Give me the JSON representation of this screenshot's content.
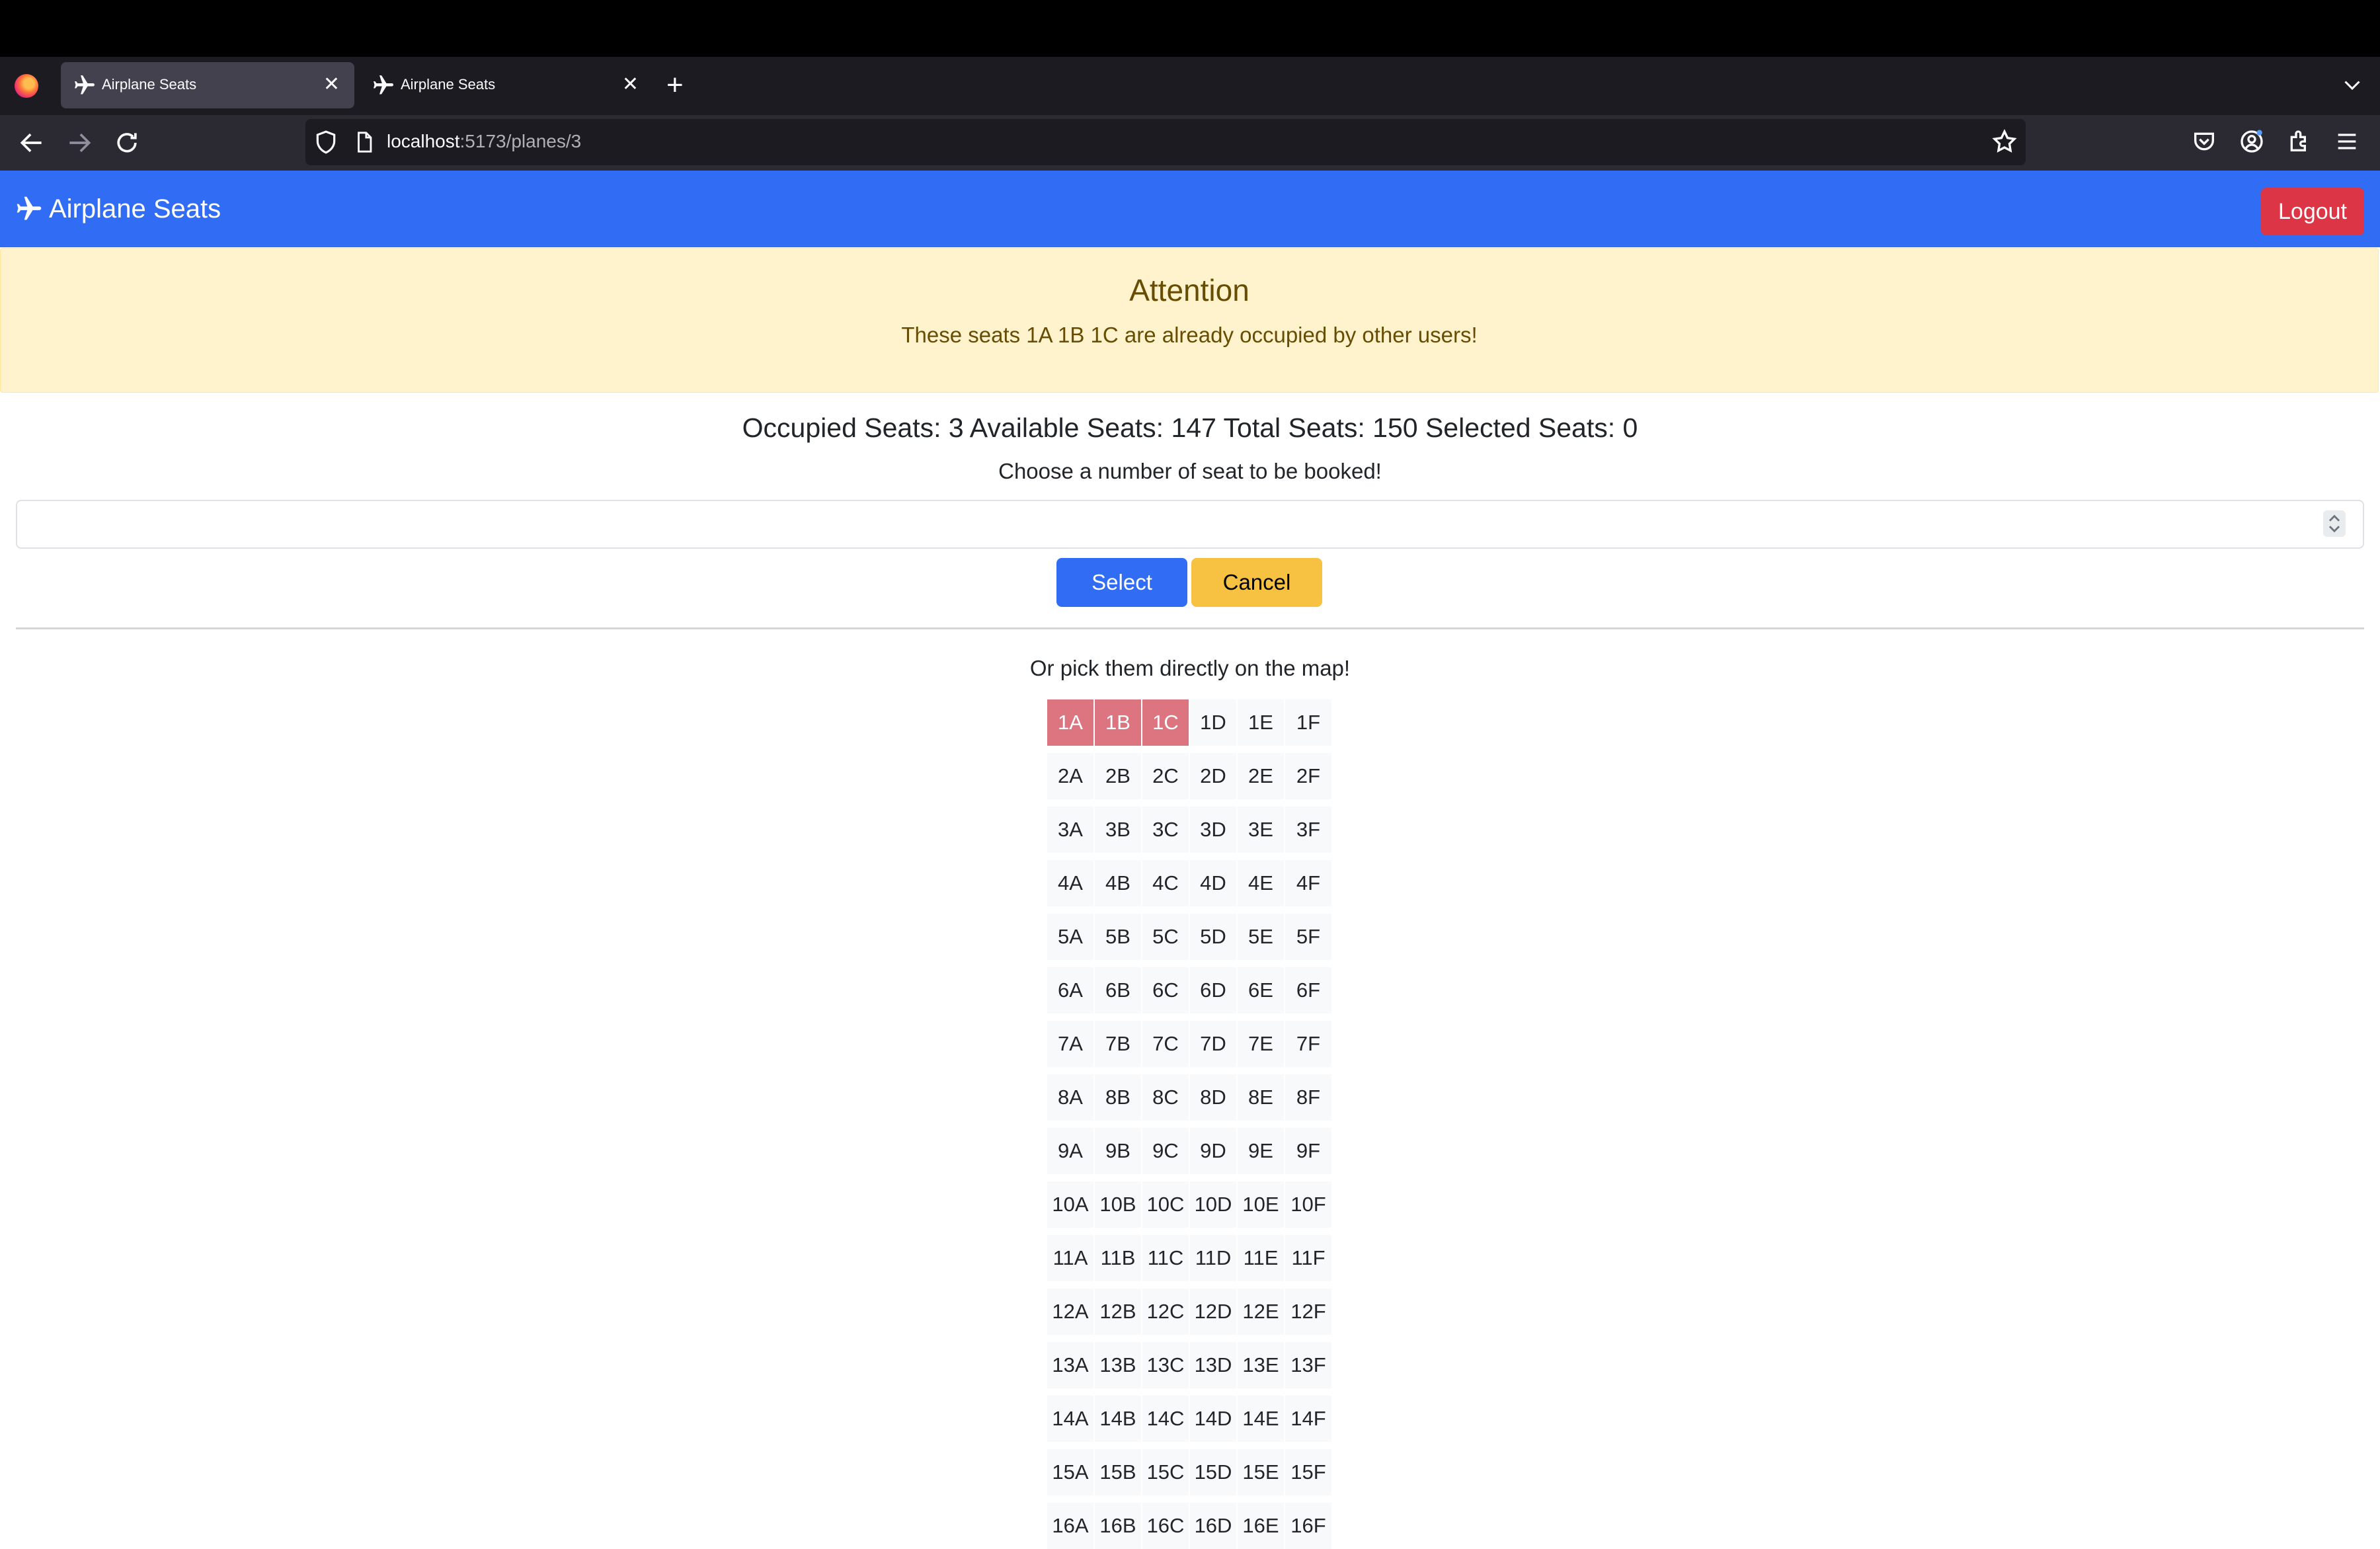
{
  "browser": {
    "tabs": [
      {
        "title": "Airplane Seats",
        "active": true
      },
      {
        "title": "Airplane Seats",
        "active": false
      }
    ],
    "url_host": "localhost",
    "url_rest": ":5173/planes/3"
  },
  "navbar": {
    "brand": "Airplane Seats",
    "logout_label": "Logout",
    "color": "#316cf4"
  },
  "alert": {
    "title": "Attention",
    "message": "These seats 1A 1B 1C are already occupied by other users!"
  },
  "stats_text": "Occupied Seats: 3 Available Seats: 147 Total Seats: 150 Selected Seats: 0",
  "choose_text": "Choose a number of seat to be booked!",
  "seat_count_input": {
    "value": ""
  },
  "buttons": {
    "select": "Select",
    "cancel": "Cancel"
  },
  "pick_text": "Or pick them directly on the map!",
  "seat_columns": [
    "A",
    "B",
    "C",
    "D",
    "E",
    "F"
  ],
  "visible_rows": [
    1,
    2,
    3,
    4,
    5,
    6,
    7,
    8,
    9,
    10,
    11,
    12,
    13,
    14,
    15,
    16
  ],
  "occupied_seats": [
    "1A",
    "1B",
    "1C"
  ],
  "colors": {
    "occupied": "#dc7580",
    "available": "#f8f9fa",
    "select_button": "#316cf4",
    "cancel_button": "#f7c141",
    "logout_button": "#dc3545"
  }
}
